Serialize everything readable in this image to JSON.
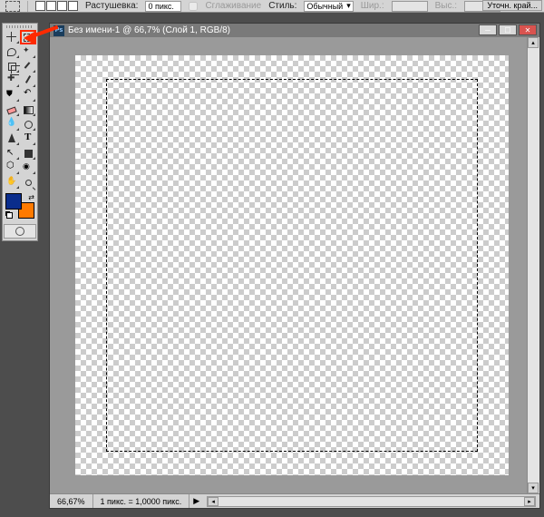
{
  "options": {
    "feather_label": "Растушевка:",
    "feather_value": "0 пикс.",
    "antialias_label": "Сглаживание",
    "style_label": "Стиль:",
    "style_value": "Обычный",
    "width_label": "Шир.:",
    "height_label": "Выс.:",
    "refine_button": "Уточн. край..."
  },
  "doc": {
    "title": "Без имени-1 @ 66,7% (Слой 1, RGB/8)"
  },
  "status": {
    "zoom": "66,67%",
    "scale": "1 пикс. = 1,0000 пикс."
  },
  "colors": {
    "fg": "#0a2d8c",
    "bg": "#ff7a00"
  }
}
